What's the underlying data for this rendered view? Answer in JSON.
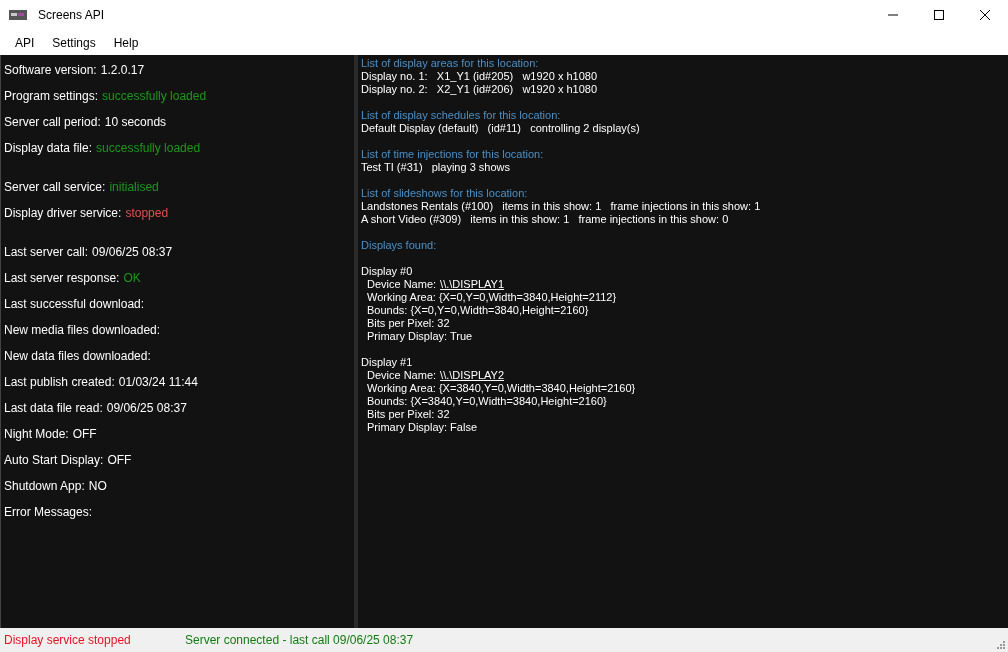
{
  "window": {
    "title": "Screens API"
  },
  "menu": [
    {
      "label": "API"
    },
    {
      "label": "Settings"
    },
    {
      "label": "Help"
    }
  ],
  "status_panel": {
    "groups": [
      [
        {
          "label": "Software version:",
          "value": "1.2.0.17",
          "kind": "plain"
        },
        {
          "label": "Program settings:",
          "value": "successfully loaded",
          "kind": "ok"
        },
        {
          "label": "Server call period:",
          "value": "10 seconds",
          "kind": "plain"
        },
        {
          "label": "Display data file:",
          "value": "successfully loaded",
          "kind": "ok"
        }
      ],
      [
        {
          "label": "Server call service:",
          "value": "initialised",
          "kind": "ok"
        },
        {
          "label": "Display driver service:",
          "value": "stopped",
          "kind": "error"
        }
      ],
      [
        {
          "label": "Last server call:",
          "value": "09/06/25 08:37",
          "kind": "plain"
        },
        {
          "label": "Last server response:",
          "value": "OK",
          "kind": "ok"
        },
        {
          "label": "Last successful download:"
        },
        {
          "label": "New media files downloaded:"
        },
        {
          "label": "New data files downloaded:"
        },
        {
          "label": "Last publish created:",
          "value": "01/03/24 11:44",
          "kind": "plain"
        },
        {
          "label": "Last data file read:",
          "value": "09/06/25 08:37",
          "kind": "plain"
        },
        {
          "label": "Night Mode:",
          "value": "OFF",
          "kind": "plain"
        },
        {
          "label": "Auto Start Display:",
          "value": "OFF",
          "kind": "plain"
        },
        {
          "label": "Shutdown App:",
          "value": "NO",
          "kind": "plain"
        },
        {
          "label": "Error Messages:"
        }
      ]
    ]
  },
  "log_panel": {
    "sections": [
      {
        "heading": "List of display areas for this location:",
        "lines": [
          "Display no. 1:   X1_Y1 (id#205)   w1920 x h1080",
          "Display no. 2:   X2_Y1 (id#206)   w1920 x h1080"
        ]
      },
      {
        "heading": "List of display schedules for this location:",
        "lines": [
          "Default Display (default)   (id#11)   controlling 2 display(s)"
        ]
      },
      {
        "heading": "List of time injections for this location:",
        "lines": [
          "Test TI (#31)   playing 3 shows"
        ]
      },
      {
        "heading": "List of slideshows for this location:",
        "lines": [
          "Landstones Rentals (#100)   items in this show: 1   frame injections in this show: 1",
          "A short Video (#309)   items in this show: 1   frame injections in this show: 0"
        ]
      }
    ],
    "displays_heading": "Displays found:",
    "displays": [
      {
        "title": "Display #0",
        "device_label": "Device Name:",
        "device_name": "\\\\.\\DISPLAY1",
        "properties": [
          "Working Area: {X=0,Y=0,Width=3840,Height=2112}",
          "Bounds: {X=0,Y=0,Width=3840,Height=2160}",
          "Bits per Pixel: 32",
          "Primary Display: True"
        ]
      },
      {
        "title": "Display #1",
        "device_label": "Device Name:",
        "device_name": "\\\\.\\DISPLAY2",
        "properties": [
          "Working Area: {X=3840,Y=0,Width=3840,Height=2160}",
          "Bounds: {X=3840,Y=0,Width=3840,Height=2160}",
          "Bits per Pixel: 32",
          "Primary Display: False"
        ]
      }
    ]
  },
  "status_bar": [
    {
      "text": "Display service stopped",
      "color": "#e81123"
    },
    {
      "text": "Server connected - last call 09/06/25 08:37",
      "color": "#107c10"
    }
  ]
}
